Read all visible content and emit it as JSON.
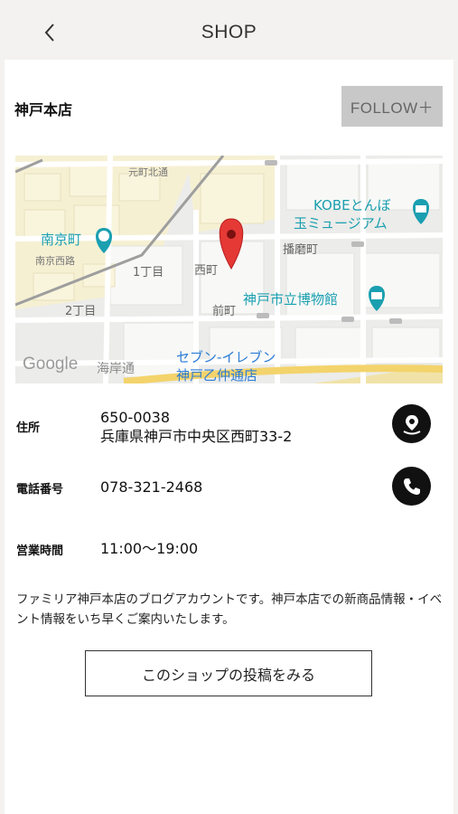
{
  "header": {
    "back_icon": "chevron-left-icon",
    "title": "SHOP"
  },
  "shop": {
    "name": "神戸本店",
    "follow_label": "FOLLOW＋"
  },
  "map": {
    "provider": "Google",
    "labels": {
      "motomachi_kitadori": "元町北通",
      "kobe_tonbo": "KOBEとんぼ",
      "tama_museum": "玉ミュージアム",
      "nankinmachi": "南京町",
      "nankin_nishiro": "南京西路",
      "harimacho": "播磨町",
      "itchome": "1丁目",
      "nishimachi": "西町",
      "kobe_museum": "神戸市立博物館",
      "nichome": "2丁目",
      "maecho": "前町",
      "seven_eleven_1": "セブン-イレブン",
      "seven_eleven_2": "神戸乙仲通店",
      "kaigandori": "海岸通"
    },
    "colors": {
      "marker": "#e53935",
      "poi_teal": "#1a9fb0",
      "label_blue": "#2c7cd6"
    }
  },
  "info": {
    "address_label": "住所",
    "postal_code": "650-0038",
    "address": "兵庫県神戸市中央区西町33-2",
    "address_icon": "map-pin-icon",
    "phone_label": "電話番号",
    "phone": "078-321-2468",
    "phone_icon": "phone-icon",
    "hours_label": "営業時間",
    "hours": "11:00〜19:00"
  },
  "description": "ファミリア神戸本店のブログアカウントです。神戸本店での新商品情報・イベント情報をいち早くご案内いたします。",
  "posts_button_label": "このショップの投稿をみる"
}
